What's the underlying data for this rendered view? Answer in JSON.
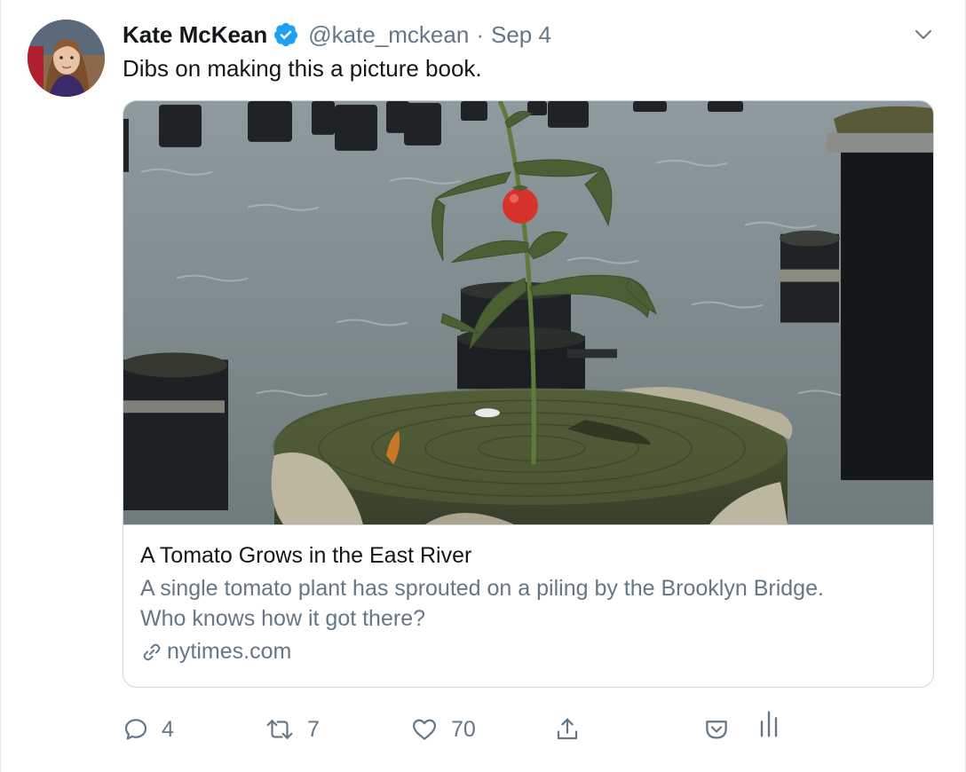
{
  "tweet": {
    "author_name": "Kate McKean",
    "handle": "@kate_mckean",
    "separator": "·",
    "date": "Sep 4",
    "text": "Dibs on making this a picture book."
  },
  "card": {
    "title": "A Tomato Grows in the East River",
    "description_line1": "A single tomato plant has sprouted on a piling by the Brooklyn Bridge.",
    "description_line2": "Who knows how it got there?",
    "domain": "nytimes.com"
  },
  "actions": {
    "reply_count": "4",
    "retweet_count": "7",
    "like_count": "70"
  },
  "icons": {
    "verified": "verified-badge-icon",
    "caret": "chevron-down-icon",
    "reply": "reply-icon",
    "retweet": "retweet-icon",
    "like": "heart-icon",
    "share": "share-icon",
    "pocket": "pocket-icon",
    "analytics": "analytics-icon",
    "link": "link-icon"
  },
  "colors": {
    "primary_text": "#14171a",
    "secondary_text": "#657786",
    "verified_blue": "#1da1f2",
    "border": "#ccd6dd"
  }
}
